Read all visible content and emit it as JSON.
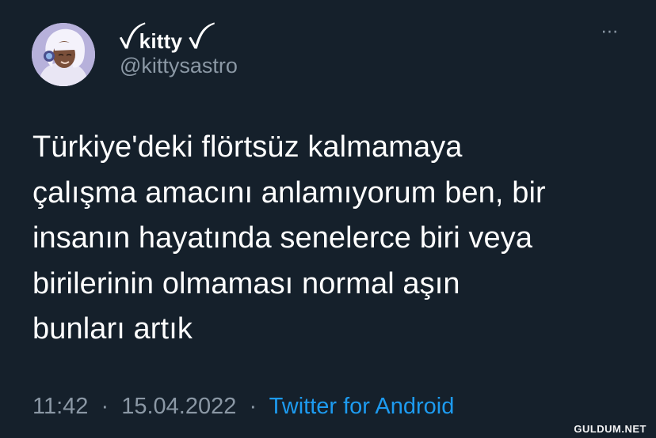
{
  "author": {
    "display_name": "ꪜ kitty ꪜ",
    "handle": "@kittysastro",
    "avatar": "avatar-image"
  },
  "menu": {
    "more_label": "⋯",
    "icon": "more-horizontal-icon"
  },
  "tweet": {
    "text": "Türkiye'deki flörtsüz kalmamaya\nçalışma amacını anlamıyorum ben, bir\ninsanın hayatında senelerce biri veya\nbirilerinin olmaması normal aşın\nbunları artık"
  },
  "meta": {
    "time": "11:42",
    "separator": "·",
    "date": "15.04.2022",
    "source": "Twitter for Android"
  },
  "watermark": {
    "text": "GULDUM.NET"
  },
  "colors": {
    "background": "#15202b",
    "primary_text": "#ffffff",
    "secondary_text": "#8b98a5",
    "link": "#1d9bf0"
  }
}
